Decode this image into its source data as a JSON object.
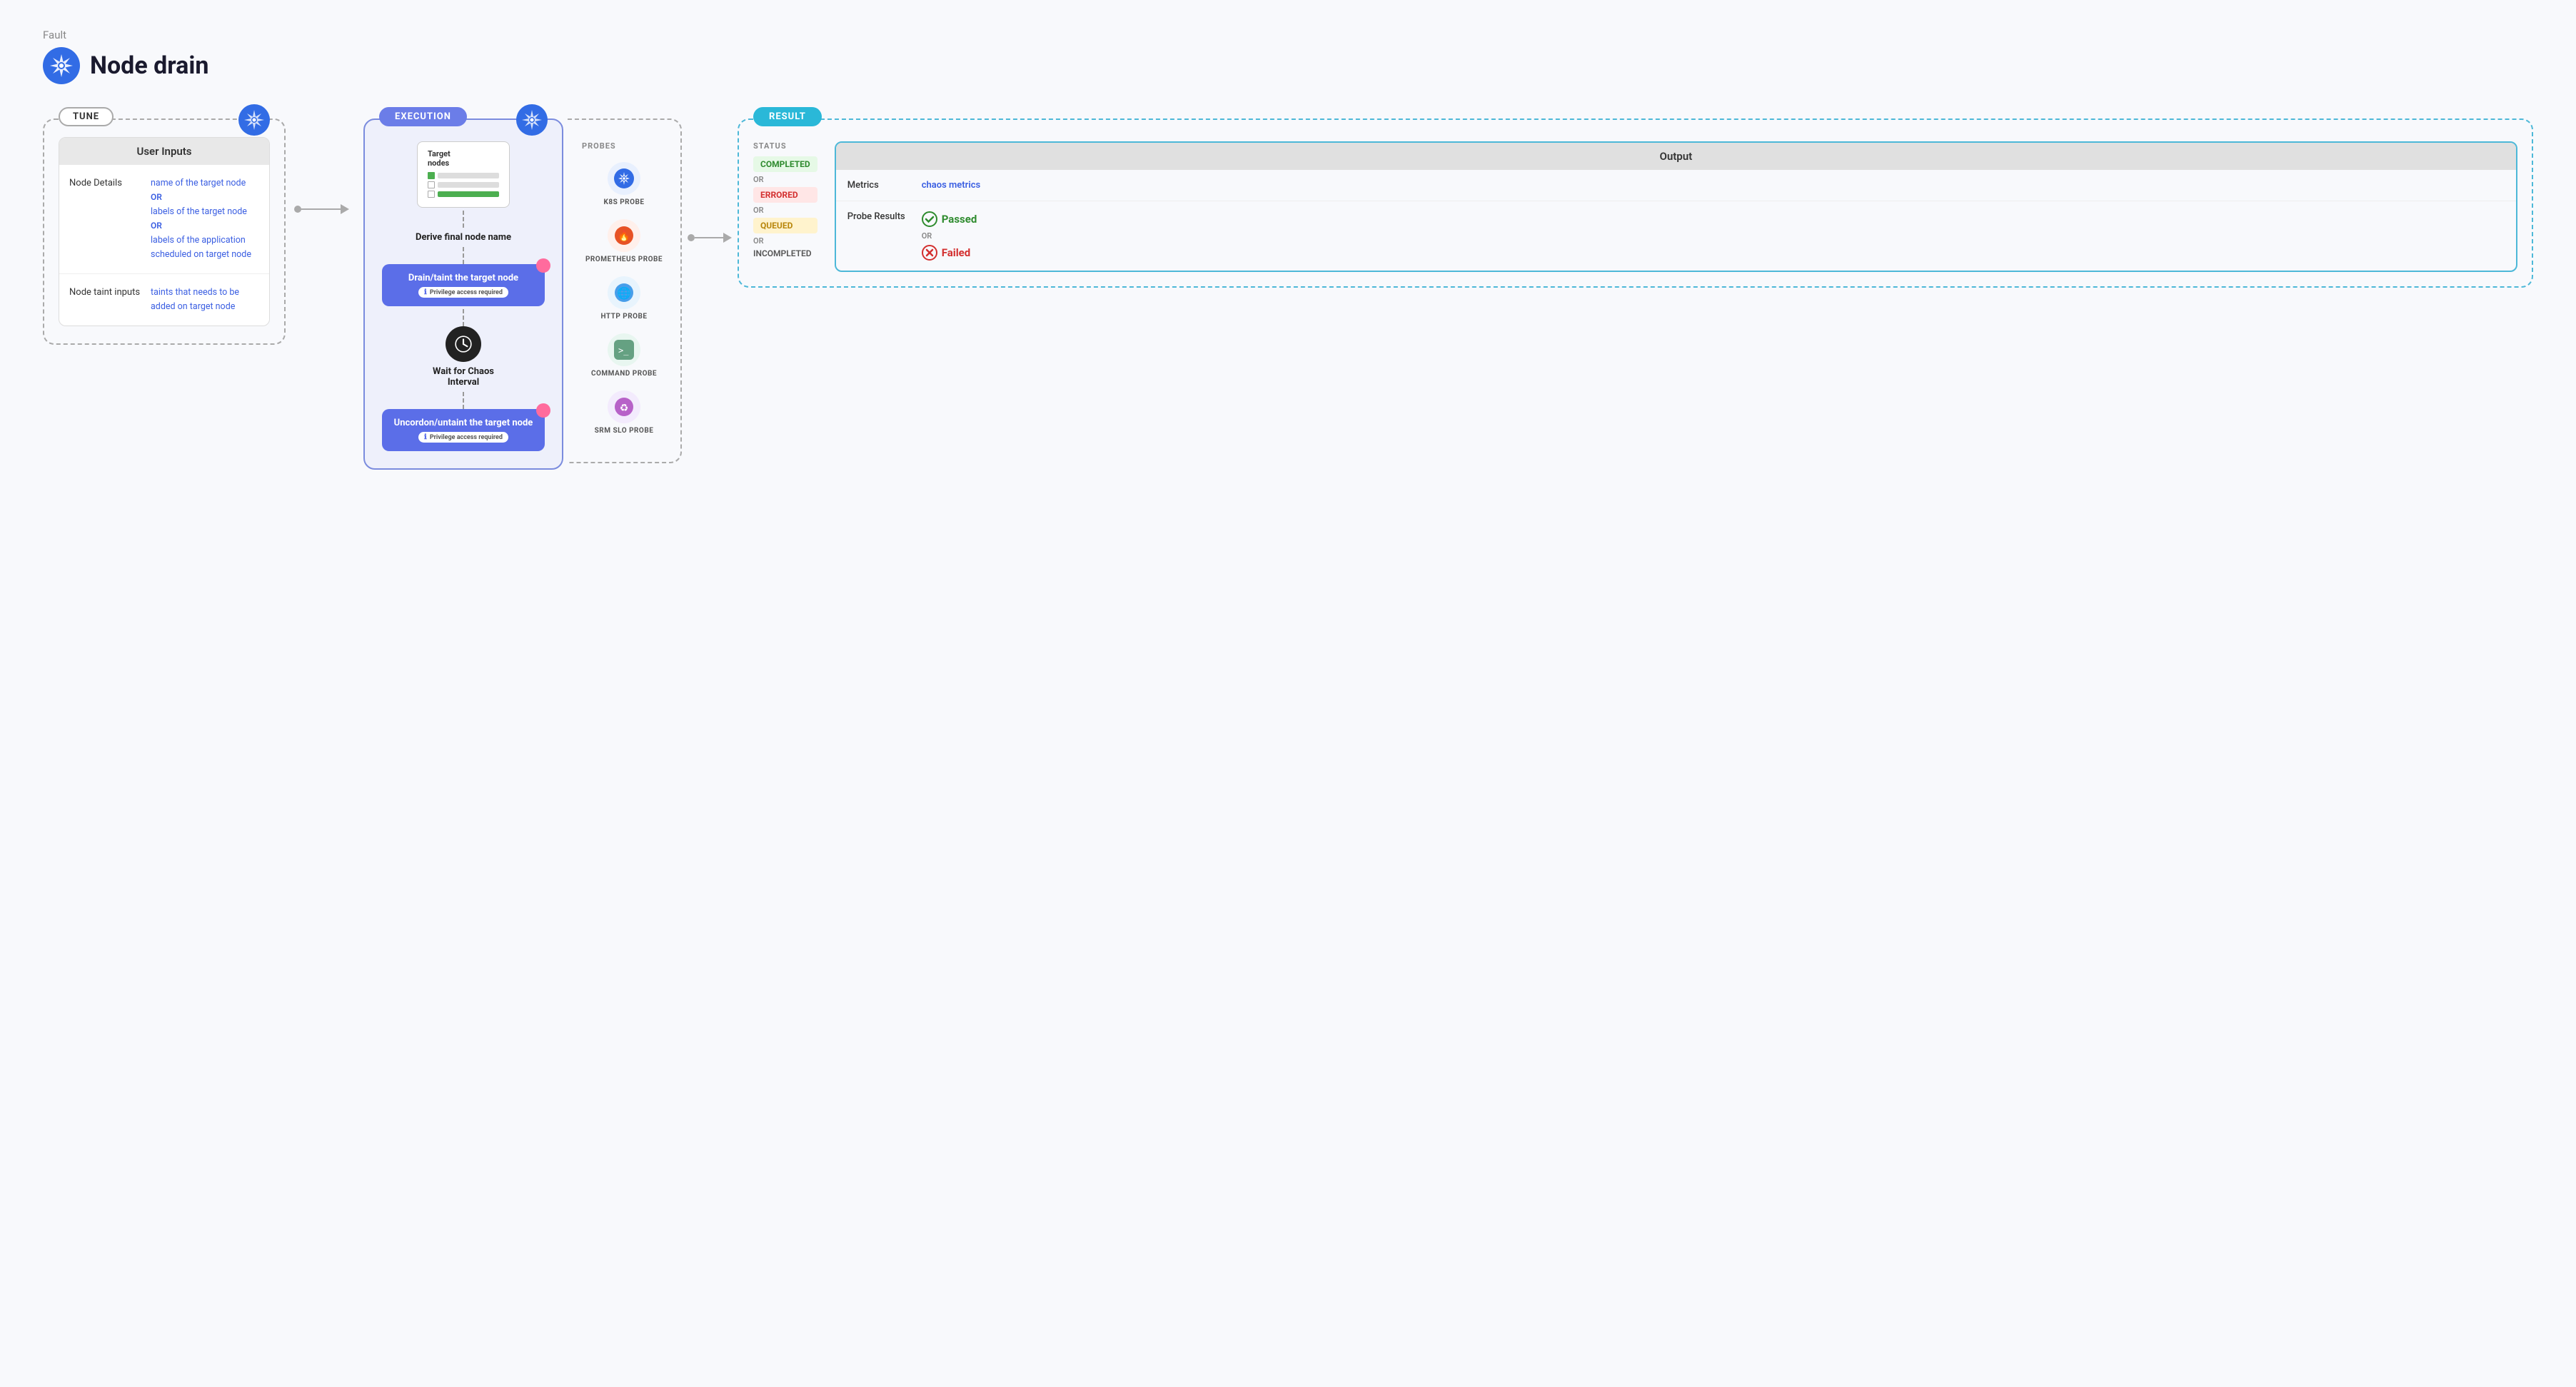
{
  "page": {
    "fault_label": "Fault",
    "title": "Node drain"
  },
  "tune": {
    "badge": "TUNE",
    "user_inputs_header": "User Inputs",
    "rows": [
      {
        "label": "Node Details",
        "values": [
          "name of the target node",
          "OR",
          "labels of the target node",
          "OR",
          "labels of the application scheduled on target node"
        ]
      },
      {
        "label": "Node taint inputs",
        "values": [
          "taints that needs to be added on target node"
        ]
      }
    ]
  },
  "execution": {
    "badge": "EXECUTION",
    "steps": [
      {
        "type": "card",
        "label": "Target\nnodes"
      },
      {
        "type": "label",
        "text": "Derive final node name"
      },
      {
        "type": "button",
        "text": "Drain/taint the target node",
        "priv": "Privilege access required"
      },
      {
        "type": "clock",
        "label": "Wait for Chaos Interval"
      },
      {
        "type": "button",
        "text": "Uncordon/untaint the target node",
        "priv": "Privilege access required"
      }
    ]
  },
  "probes": {
    "label": "PROBES",
    "items": [
      {
        "name": "K8S PROBE",
        "icon_type": "k8s"
      },
      {
        "name": "PROMETHEUS PROBE",
        "icon_type": "prometheus"
      },
      {
        "name": "HTTP PROBE",
        "icon_type": "http"
      },
      {
        "name": "COMMAND PROBE",
        "icon_type": "command"
      },
      {
        "name": "SRM SLO PROBE",
        "icon_type": "srm"
      }
    ]
  },
  "result": {
    "badge": "RESULT",
    "status_label": "STATUS",
    "statuses": [
      {
        "text": "COMPLETED",
        "type": "completed"
      },
      {
        "or": "OR"
      },
      {
        "text": "ERRORED",
        "type": "errored"
      },
      {
        "or": "OR"
      },
      {
        "text": "QUEUED",
        "type": "queued"
      },
      {
        "or": "OR"
      },
      {
        "text": "INCOMPLETED",
        "type": "incompleted"
      }
    ],
    "output": {
      "header": "Output",
      "metrics_label": "Metrics",
      "metrics_value": "chaos metrics",
      "probe_label": "Probe Results",
      "passed": "Passed",
      "or": "OR",
      "failed": "Failed"
    }
  }
}
